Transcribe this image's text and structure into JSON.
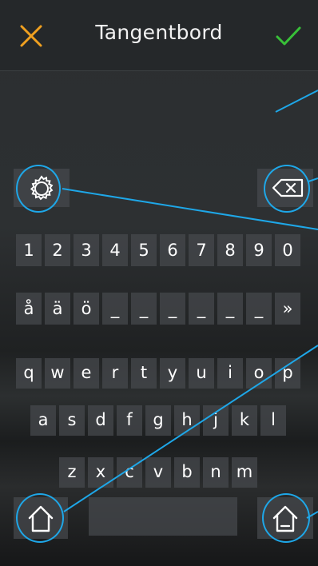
{
  "header": {
    "title": "Tangentbord",
    "cancel_icon": "close-icon",
    "confirm_icon": "check-icon"
  },
  "keyboard": {
    "number_row": [
      "1",
      "2",
      "3",
      "4",
      "5",
      "6",
      "7",
      "8",
      "9",
      "0"
    ],
    "special_row": [
      "å",
      "ä",
      "ö",
      "_",
      "_",
      "_",
      "_",
      "_",
      "_",
      "»"
    ],
    "row_q": [
      "q",
      "w",
      "e",
      "r",
      "t",
      "y",
      "u",
      "i",
      "o",
      "p"
    ],
    "row_a": [
      "a",
      "s",
      "d",
      "f",
      "g",
      "h",
      "j",
      "k",
      "l"
    ],
    "row_z": [
      "z",
      "x",
      "c",
      "v",
      "b",
      "n",
      "m"
    ],
    "settings_icon": "gear-icon",
    "backspace_icon": "backspace-icon",
    "home_icon": "home-icon"
  },
  "colors": {
    "cancel": "#f0a020",
    "confirm": "#38c038",
    "callout": "#1ea7e8"
  }
}
